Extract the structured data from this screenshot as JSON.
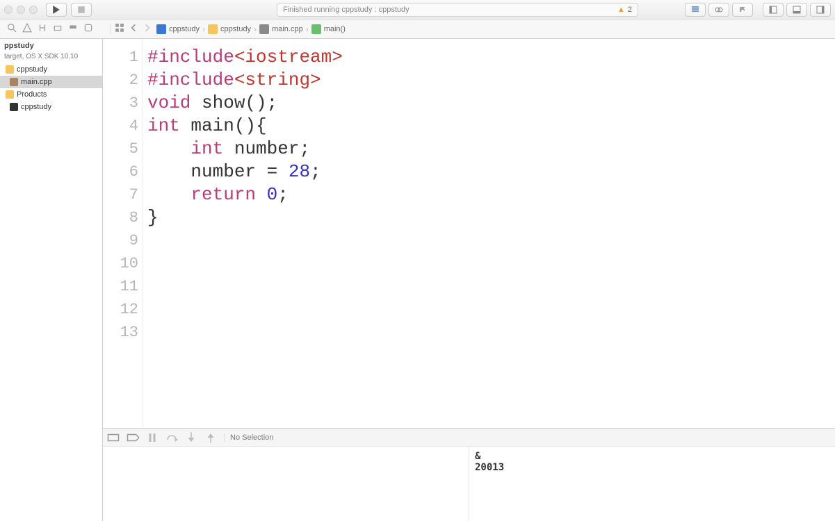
{
  "toolbar": {
    "status_text": "Finished running cppstudy : cppstudy",
    "warn_count": "2"
  },
  "breadcrumb": {
    "project": "cppstudy",
    "folder": "cppstudy",
    "file": "main.cpp",
    "symbol": "main()"
  },
  "sidebar": {
    "header": "ppstudy",
    "subheader": "target, OS X SDK 10.10",
    "items": [
      {
        "label": "cppstudy",
        "icon": "folder",
        "selected": false,
        "level": 0
      },
      {
        "label": "main.cpp",
        "icon": "file",
        "selected": true,
        "level": 1
      },
      {
        "label": "Products",
        "icon": "folder",
        "selected": false,
        "level": 0
      },
      {
        "label": "cppstudy",
        "icon": "term",
        "selected": false,
        "level": 1
      }
    ]
  },
  "code": {
    "max_lines": 13,
    "lines": [
      {
        "n": "1",
        "tokens": [
          {
            "t": "#include",
            "c": "kw"
          },
          {
            "t": "<iostream>",
            "c": "hdr"
          }
        ]
      },
      {
        "n": "2",
        "tokens": [
          {
            "t": "#include",
            "c": "kw"
          },
          {
            "t": "<string>",
            "c": "hdr"
          }
        ]
      },
      {
        "n": "3",
        "tokens": [
          {
            "t": "void",
            "c": "kw"
          },
          {
            "t": " show();",
            "c": "plain"
          }
        ]
      },
      {
        "n": "4",
        "tokens": [
          {
            "t": "int",
            "c": "kw"
          },
          {
            "t": " main(){",
            "c": "plain"
          }
        ]
      },
      {
        "n": "5",
        "tokens": [
          {
            "t": "",
            "c": "plain"
          }
        ]
      },
      {
        "n": "6",
        "tokens": [
          {
            "t": "    ",
            "c": "plain"
          },
          {
            "t": "int",
            "c": "kw"
          },
          {
            "t": " number;",
            "c": "plain"
          }
        ]
      },
      {
        "n": "7",
        "tokens": [
          {
            "t": "    number = ",
            "c": "plain"
          },
          {
            "t": "28",
            "c": "num"
          },
          {
            "t": ";",
            "c": "plain"
          }
        ]
      },
      {
        "n": "8",
        "tokens": [
          {
            "t": "    ",
            "c": "plain"
          },
          {
            "t": "return",
            "c": "kw"
          },
          {
            "t": " ",
            "c": "plain"
          },
          {
            "t": "0",
            "c": "num"
          },
          {
            "t": ";",
            "c": "plain"
          }
        ]
      },
      {
        "n": "9",
        "tokens": [
          {
            "t": "",
            "c": "plain"
          }
        ]
      },
      {
        "n": "10",
        "tokens": [
          {
            "t": "}",
            "c": "plain"
          }
        ]
      },
      {
        "n": "11",
        "tokens": [
          {
            "t": "",
            "c": "plain"
          }
        ]
      },
      {
        "n": "12",
        "tokens": [
          {
            "t": "",
            "c": "plain"
          }
        ]
      },
      {
        "n": "13",
        "tokens": [
          {
            "t": "",
            "c": "plain"
          }
        ]
      }
    ]
  },
  "debug": {
    "selection_text": "No Selection"
  },
  "console": {
    "line1": "&",
    "line2": "20013"
  }
}
